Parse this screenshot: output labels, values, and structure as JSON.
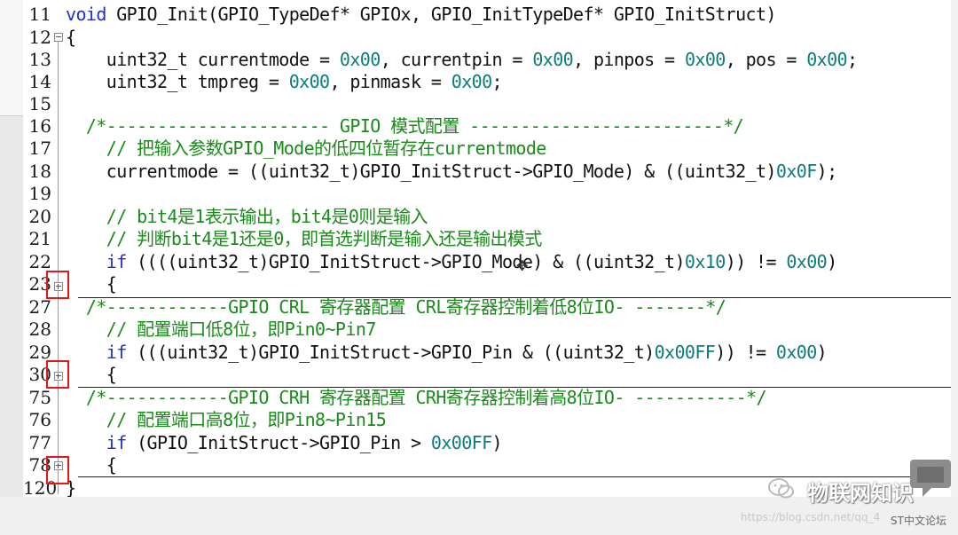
{
  "lines": [
    {
      "num": "11",
      "text": "void GPIO_Init(GPIO_TypeDef* GPIOx, GPIO_InitTypeDef* GPIO_InitStruct)"
    },
    {
      "num": "12",
      "text": "{"
    },
    {
      "num": "13",
      "text": "    uint32_t currentmode = 0x00, currentpin = 0x00, pinpos = 0x00, pos = 0x00;"
    },
    {
      "num": "14",
      "text": "    uint32_t tmpreg = 0x00, pinmask = 0x00;"
    },
    {
      "num": "15",
      "text": ""
    },
    {
      "num": "16",
      "text": "  /*---------------------- GPIO 模式配置 -------------------------*/"
    },
    {
      "num": "17",
      "text": "    // 把输入参数GPIO_Mode的低四位暂存在currentmode"
    },
    {
      "num": "18",
      "text": "    currentmode = ((uint32_t)GPIO_InitStruct->GPIO_Mode) & ((uint32_t)0x0F);"
    },
    {
      "num": "19",
      "text": ""
    },
    {
      "num": "20",
      "text": "    // bit4是1表示输出，bit4是0则是输入"
    },
    {
      "num": "21",
      "text": "    // 判断bit4是1还是0，即首选判断是输入还是输出模式"
    },
    {
      "num": "22",
      "text": "    if ((((uint32_t)GPIO_InitStruct->GPIO_Mode) & ((uint32_t)0x10)) != 0x00)"
    },
    {
      "num": "23",
      "text": "    {"
    },
    {
      "num": "27",
      "text": "  /*------------GPIO CRL 寄存器配置 CRL寄存器控制着低8位IO- -------*/"
    },
    {
      "num": "28",
      "text": "    // 配置端口低8位，即Pin0~Pin7"
    },
    {
      "num": "29",
      "text": "    if (((uint32_t)GPIO_InitStruct->GPIO_Pin & ((uint32_t)0x00FF)) != 0x00)"
    },
    {
      "num": "30",
      "text": "    {"
    },
    {
      "num": "75",
      "text": "  /*------------GPIO CRH 寄存器配置 CRH寄存器控制着高8位IO- -----------*/"
    },
    {
      "num": "76",
      "text": "    // 配置端口高8位，即Pin8~Pin15"
    },
    {
      "num": "77",
      "text": "    if (GPIO_InitStruct->GPIO_Pin > 0x00FF)"
    },
    {
      "num": "78",
      "text": "    {"
    },
    {
      "num": "120",
      "text": "}"
    }
  ],
  "watermark": {
    "title": "物联网知识",
    "url": "https://blog.csdn.net/qq_4",
    "forum": "ST中文论坛"
  },
  "colors": {
    "keyword": "#1f2fd0",
    "number": "#0a7d7a",
    "comment": "#1a8a1a",
    "highlight_box": "#e01818"
  },
  "icons": {
    "fold_expanded": "minus-box-icon",
    "fold_collapsed": "plus-box-icon",
    "watermark_logo": "wechat-icon",
    "chat": "chat-bubble-icon"
  }
}
